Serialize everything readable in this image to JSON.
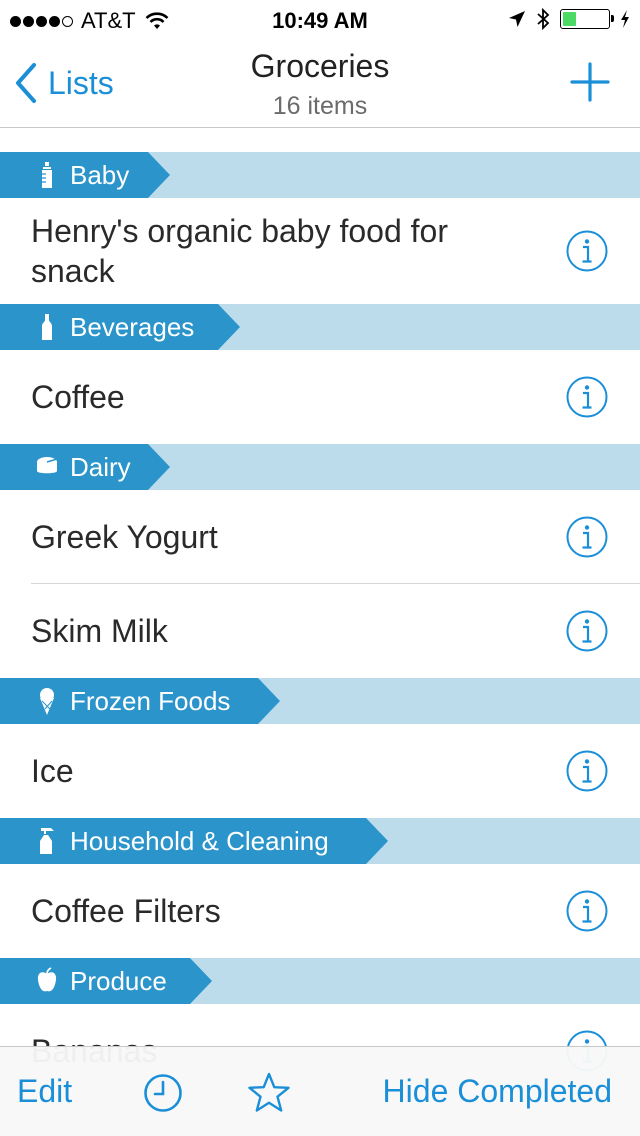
{
  "status_bar": {
    "carrier": "AT&T",
    "time": "10:49 AM",
    "signal_bars": 4,
    "signal_max": 5,
    "battery_level": 0.3
  },
  "nav": {
    "back_label": "Lists",
    "title": "Groceries",
    "subtitle": "16 items"
  },
  "sections": [
    {
      "name": "Baby",
      "icon": "baby-bottle-icon",
      "items": [
        "Henry's organic baby food for snack"
      ]
    },
    {
      "name": "Beverages",
      "icon": "bottle-icon",
      "items": [
        "Coffee"
      ]
    },
    {
      "name": "Dairy",
      "icon": "cheese-icon",
      "items": [
        "Greek Yogurt",
        "Skim Milk"
      ]
    },
    {
      "name": "Frozen Foods",
      "icon": "ice-cream-icon",
      "items": [
        "Ice"
      ]
    },
    {
      "name": "Household & Cleaning",
      "icon": "spray-bottle-icon",
      "items": [
        "Coffee Filters"
      ]
    },
    {
      "name": "Produce",
      "icon": "apple-icon",
      "items": [
        "Bananas"
      ]
    }
  ],
  "toolbar": {
    "edit_label": "Edit",
    "clock_icon": "clock-icon",
    "star_icon": "star-icon",
    "hide_completed_label": "Hide Completed"
  },
  "colors": {
    "accent": "#1a8fd8",
    "section_tag": "#2b94cb",
    "section_band": "#bcdcec"
  }
}
